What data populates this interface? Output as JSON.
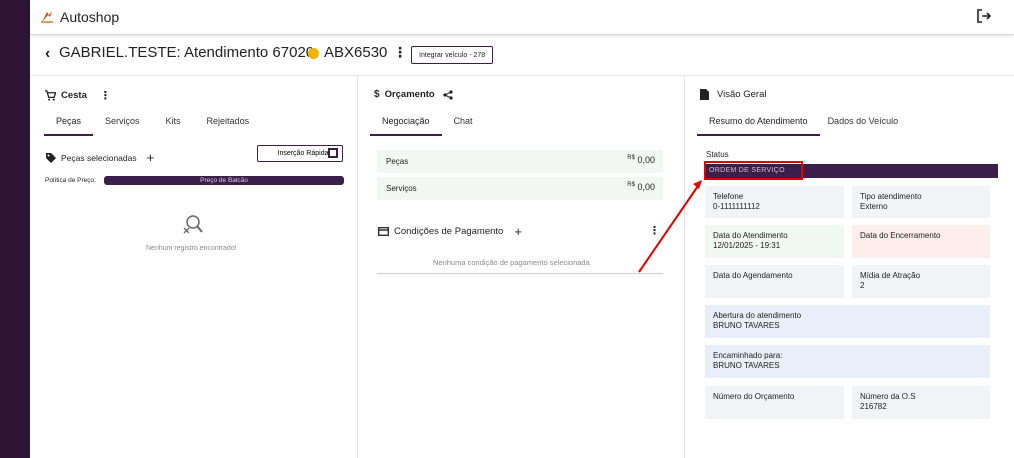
{
  "app": {
    "title": "Autoshop"
  },
  "header": {
    "title": "GABRIEL.TESTE: Atendimento 67020",
    "plate": "ABX6530",
    "integrate_button": "Integrar veículo - 278"
  },
  "cesta": {
    "title": "Cesta",
    "tabs": [
      "Peças",
      "Serviços",
      "Kits",
      "Rejeitados"
    ],
    "selected_label": "Peças selecionadas",
    "quick_insert": "Inserção Rápida",
    "price_policy_label": "Política de Preço:",
    "price_policy_value": "Preço de Balcão",
    "empty_text": "Nenhum registro encontrado!"
  },
  "orcamento": {
    "title": "Orçamento",
    "tabs": [
      "Negociação",
      "Chat"
    ],
    "rows": [
      {
        "label": "Peças",
        "currency": "R$",
        "value": "0,00"
      },
      {
        "label": "Serviços",
        "currency": "R$",
        "value": "0,00"
      }
    ],
    "conditions_title": "Condições de Pagamento",
    "conditions_empty": "Nenhuma condição de pagamento selecionada"
  },
  "visao": {
    "title": "Visão Geral",
    "tabs": [
      "Resumo do Atendimento",
      "Dados do Veículo"
    ],
    "status_label": "Status",
    "status_value": "ORDEM DE SERVIÇO",
    "cards": {
      "telefone": {
        "label": "Telefone",
        "value": "0-1111111112"
      },
      "tipo": {
        "label": "Tipo atendimento",
        "value": "Externo"
      },
      "data_atendimento": {
        "label": "Data do Atendimento",
        "value": "12/01/2025 - 19:31"
      },
      "data_encerramento": {
        "label": "Data do Encerramento",
        "value": ""
      },
      "data_agendamento": {
        "label": "Data do Agendamento",
        "value": ""
      },
      "midia": {
        "label": "Mídia de Atração",
        "value": "2"
      },
      "abertura": {
        "label": "Abertura do atendimento",
        "value": "BRUNO TAVARES"
      },
      "encaminhado": {
        "label": "Encaminhado para:",
        "value": "BRUNO TAVARES"
      },
      "numero_orcamento": {
        "label": "Número do Orçamento",
        "value": ""
      },
      "numero_os": {
        "label": "Número da O.S",
        "value": "216782"
      }
    }
  },
  "colors": {
    "brand_dark": "#3b1f4a",
    "sidebar": "#2e1537",
    "status_dot": "#f0b400",
    "annotation_red": "#e00000"
  },
  "icons": [
    "logo-icon",
    "logout-icon",
    "cart-icon",
    "dollar-icon",
    "share-icon",
    "document-icon",
    "tag-icon",
    "plus-icon",
    "kebab-menu-icon",
    "search-empty-icon",
    "card-icon",
    "qr-icon",
    "chevron-left-icon"
  ]
}
